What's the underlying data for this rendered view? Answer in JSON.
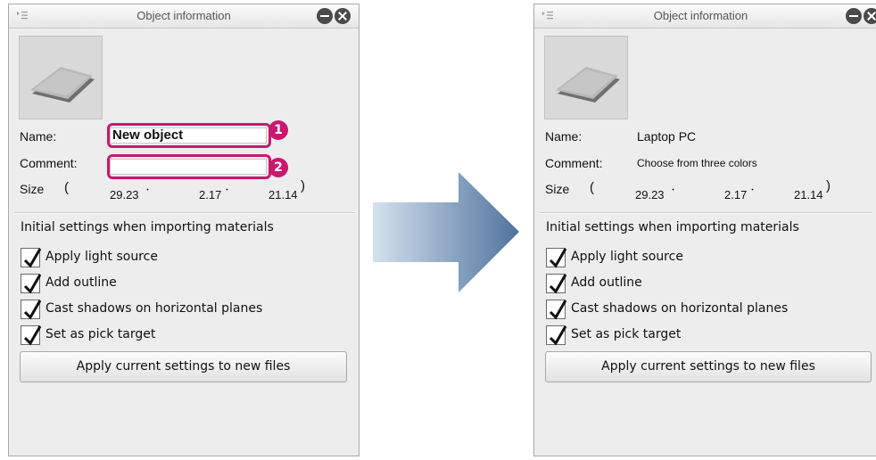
{
  "before_panel": {
    "title": "Object information",
    "name_label": "Name:",
    "name_value": "New object",
    "comment_label": "Comment:",
    "comment_value": "",
    "size_label": "Size",
    "size_open": "(",
    "size_close": ")",
    "size_x": "29.23",
    "size_y": "2.17",
    "size_z": "21.14",
    "size_sep": "・",
    "callout_1": "1",
    "callout_2": "2",
    "section_heading": "Initial settings when importing materials",
    "checkboxes": [
      {
        "label": "Apply light source",
        "checked": true
      },
      {
        "label": "Add outline",
        "checked": true
      },
      {
        "label": "Cast shadows on horizontal planes",
        "checked": true
      },
      {
        "label": "Set as pick target",
        "checked": true
      }
    ],
    "apply_button_label": "Apply current settings to new files"
  },
  "after_panel": {
    "title": "Object information",
    "name_label": "Name:",
    "name_value": "Laptop PC",
    "comment_label": "Comment:",
    "comment_value": "Choose from three colors",
    "size_label": "Size",
    "size_open": "(",
    "size_close": ")",
    "size_x": "29.23",
    "size_y": "2.17",
    "size_z": "21.14",
    "size_sep": "・",
    "section_heading": "Initial settings when importing materials",
    "checkboxes": [
      {
        "label": "Apply light source",
        "checked": true
      },
      {
        "label": "Add outline",
        "checked": true
      },
      {
        "label": "Cast shadows on horizontal planes",
        "checked": true
      },
      {
        "label": "Set as pick target",
        "checked": true
      }
    ],
    "apply_button_label": "Apply current settings to new files"
  },
  "icons": {
    "menu": "panel-menu-icon",
    "minimize": "minimize-icon",
    "close": "close-icon",
    "arrow": "right-arrow-icon",
    "check": "checkmark-icon"
  },
  "colors": {
    "callout_accent": "#c8196e",
    "arrow_start": "#d5e1ee",
    "arrow_end": "#4f739e",
    "panel_bg": "#ededed"
  }
}
